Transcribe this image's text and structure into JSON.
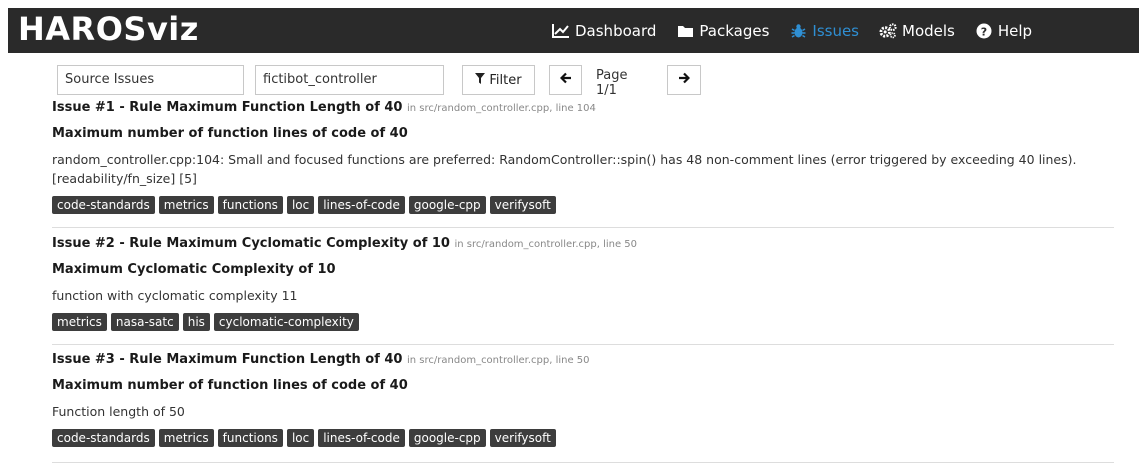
{
  "brand": "HAROSviz",
  "nav": {
    "dashboard": "Dashboard",
    "packages": "Packages",
    "issues": "Issues",
    "models": "Models",
    "help": "Help"
  },
  "toolbar": {
    "source_select": "Source Issues",
    "target_select": "fictibot_controller",
    "filter_label": "Filter",
    "page_label": "Page 1/1"
  },
  "issues": [
    {
      "title": "Issue #1 - Rule Maximum Function Length of 40",
      "location": "in src/random_controller.cpp, line 104",
      "heading": "Maximum number of function lines of code of 40",
      "text_line1": "random_controller.cpp:104: Small and focused functions are preferred: RandomController::spin() has 48 non-comment lines (error triggered by exceeding 40 lines).",
      "text_line2": "[readability/fn_size] [5]",
      "tags": [
        "code-standards",
        "metrics",
        "functions",
        "loc",
        "lines-of-code",
        "google-cpp",
        "verifysoft"
      ]
    },
    {
      "title": "Issue #2 - Rule Maximum Cyclomatic Complexity of 10",
      "location": "in src/random_controller.cpp, line 50",
      "heading": "Maximum Cyclomatic Complexity of 10",
      "text_line1": "function with cyclomatic complexity 11",
      "tags": [
        "metrics",
        "nasa-satc",
        "his",
        "cyclomatic-complexity"
      ]
    },
    {
      "title": "Issue #3 - Rule Maximum Function Length of 40",
      "location": "in src/random_controller.cpp, line 50",
      "heading": "Maximum number of function lines of code of 40",
      "text_line1": "Function length of 50",
      "tags": [
        "code-standards",
        "metrics",
        "functions",
        "loc",
        "lines-of-code",
        "google-cpp",
        "verifysoft"
      ]
    }
  ]
}
